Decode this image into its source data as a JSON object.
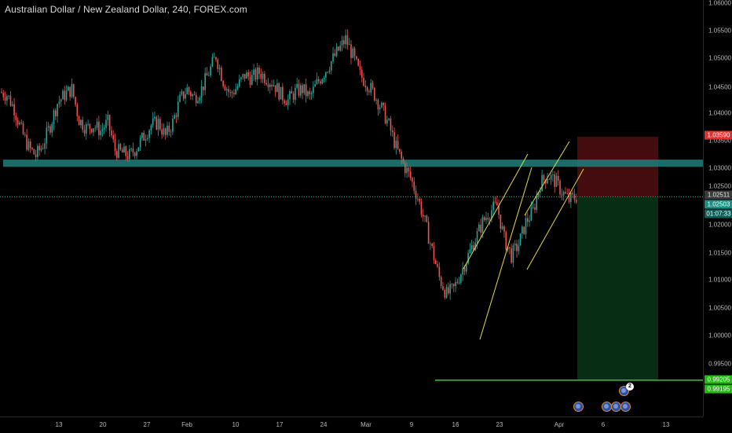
{
  "header": {
    "title": "Australian Dollar / New Zealand Dollar, 240, FOREX.com"
  },
  "colors": {
    "up": "#26a69a",
    "down": "#ef5350",
    "zone": "#1f7f7a",
    "channel": "#e5d94a",
    "stop_zone": "#4d0d12",
    "target_zone": "#093217",
    "target_line": "#2dd11a",
    "current_line": "#26a69a"
  },
  "price_axis": {
    "ticks": [
      "1.06000",
      "1.05500",
      "1.05000",
      "1.04500",
      "1.04000",
      "1.03500",
      "1.03000",
      "1.02500",
      "1.02000",
      "1.01500",
      "1.01000",
      "1.00500",
      "1.00000",
      "0.99500"
    ]
  },
  "price_tags": {
    "stop": "1.03590",
    "last": "1.02511",
    "entry": "1.02503",
    "countdown": "01:07:33",
    "target": "0.99205",
    "target2": "0.99195"
  },
  "time_axis": {
    "ticks": [
      "13",
      "20",
      "27",
      "Feb",
      "10",
      "17",
      "24",
      "Mar",
      "9",
      "16",
      "23",
      "Apr",
      "6",
      "13"
    ]
  },
  "events": {
    "badge_count": "2"
  },
  "chart_data": {
    "type": "candlestick",
    "title": "Australian Dollar / New Zealand Dollar, 240, FOREX.com",
    "ylim": [
      0.9905,
      1.0615
    ],
    "y_ticks": [
      1.06,
      1.055,
      1.05,
      1.045,
      1.04,
      1.035,
      1.03,
      1.025,
      1.02,
      1.015,
      1.01,
      1.005,
      1.0,
      0.995
    ],
    "x_ticks": [
      "13",
      "20",
      "27",
      "Feb",
      "10",
      "17",
      "24",
      "Mar",
      "9",
      "16",
      "23",
      "Apr",
      "6",
      "13"
    ],
    "price_path": [
      1.044,
      1.0435,
      1.041,
      1.037,
      1.034,
      1.0325,
      1.0345,
      1.038,
      1.042,
      1.0435,
      1.0445,
      1.039,
      1.0375,
      1.038,
      1.037,
      1.0385,
      1.0335,
      1.033,
      1.0325,
      1.034,
      1.036,
      1.038,
      1.0385,
      1.036,
      1.0385,
      1.0425,
      1.0445,
      1.043,
      1.0445,
      1.0475,
      1.0505,
      1.046,
      1.0435,
      1.045,
      1.047,
      1.0465,
      1.0475,
      1.0465,
      1.0455,
      1.0435,
      1.0425,
      1.044,
      1.0445,
      1.043,
      1.0455,
      1.0475,
      1.0495,
      1.0515,
      1.0535,
      1.0505,
      1.047,
      1.0455,
      1.0435,
      1.041,
      1.038,
      1.034,
      1.031,
      1.0285,
      1.025,
      1.0205,
      1.0155,
      1.0105,
      1.0075,
      1.0085,
      1.0115,
      1.0145,
      1.0175,
      1.0205,
      1.0225,
      1.0235,
      1.0175,
      1.0145,
      1.0165,
      1.0205,
      1.0225,
      1.0275,
      1.029,
      1.028,
      1.026,
      1.0245,
      1.0251
    ],
    "support_resistance_zone": [
      1.0305,
      1.0318
    ],
    "trade": {
      "entry": 1.02503,
      "stop": 1.0359,
      "target": 0.99205
    },
    "channels": [
      {
        "lower": [
          [
            0.2,
            0.9995
          ],
          [
            0.9,
            1.029
          ]
        ],
        "upper": [
          [
            0.0,
            1.0105
          ],
          [
            0.75,
            1.0315
          ]
        ]
      },
      {
        "lower": [
          [
            0.0,
            1.012
          ],
          [
            1.0,
            1.029
          ]
        ],
        "upper": [
          [
            0.0,
            1.0195
          ],
          [
            0.85,
            1.0345
          ]
        ]
      }
    ]
  }
}
